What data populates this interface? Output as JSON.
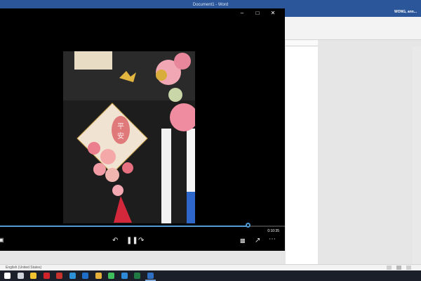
{
  "word": {
    "title": "Document1 - Word",
    "user": "WONG, ann...",
    "status_language": "English (United States)"
  },
  "player": {
    "current_time": "0:10:35",
    "progress": 0.87
  },
  "taskbar": {
    "icons": [
      {
        "name": "start-icon",
        "color": "#ffffff"
      },
      {
        "name": "task-view-icon",
        "color": "#cfd3da"
      },
      {
        "name": "file-explorer-icon",
        "color": "#f2c230"
      },
      {
        "name": "acrobat-icon",
        "color": "#d1232a"
      },
      {
        "name": "folder-red-icon",
        "color": "#c8322c"
      },
      {
        "name": "edge-icon",
        "color": "#2d8fd6"
      },
      {
        "name": "outlook-icon",
        "color": "#1f6ec8"
      },
      {
        "name": "chrome-icon",
        "color": "#e6b13a"
      },
      {
        "name": "whatsapp-icon",
        "color": "#3fbf5c"
      },
      {
        "name": "ie-icon",
        "color": "#2e8ad7"
      },
      {
        "name": "excel-icon",
        "color": "#1f7a43"
      },
      {
        "name": "movies-tv-icon",
        "color": "#2f6fc2"
      }
    ]
  },
  "colors": {
    "word_blue": "#2b579a",
    "seek_blue": "#4f9cd6",
    "taskbar": "#1b1f2a"
  }
}
